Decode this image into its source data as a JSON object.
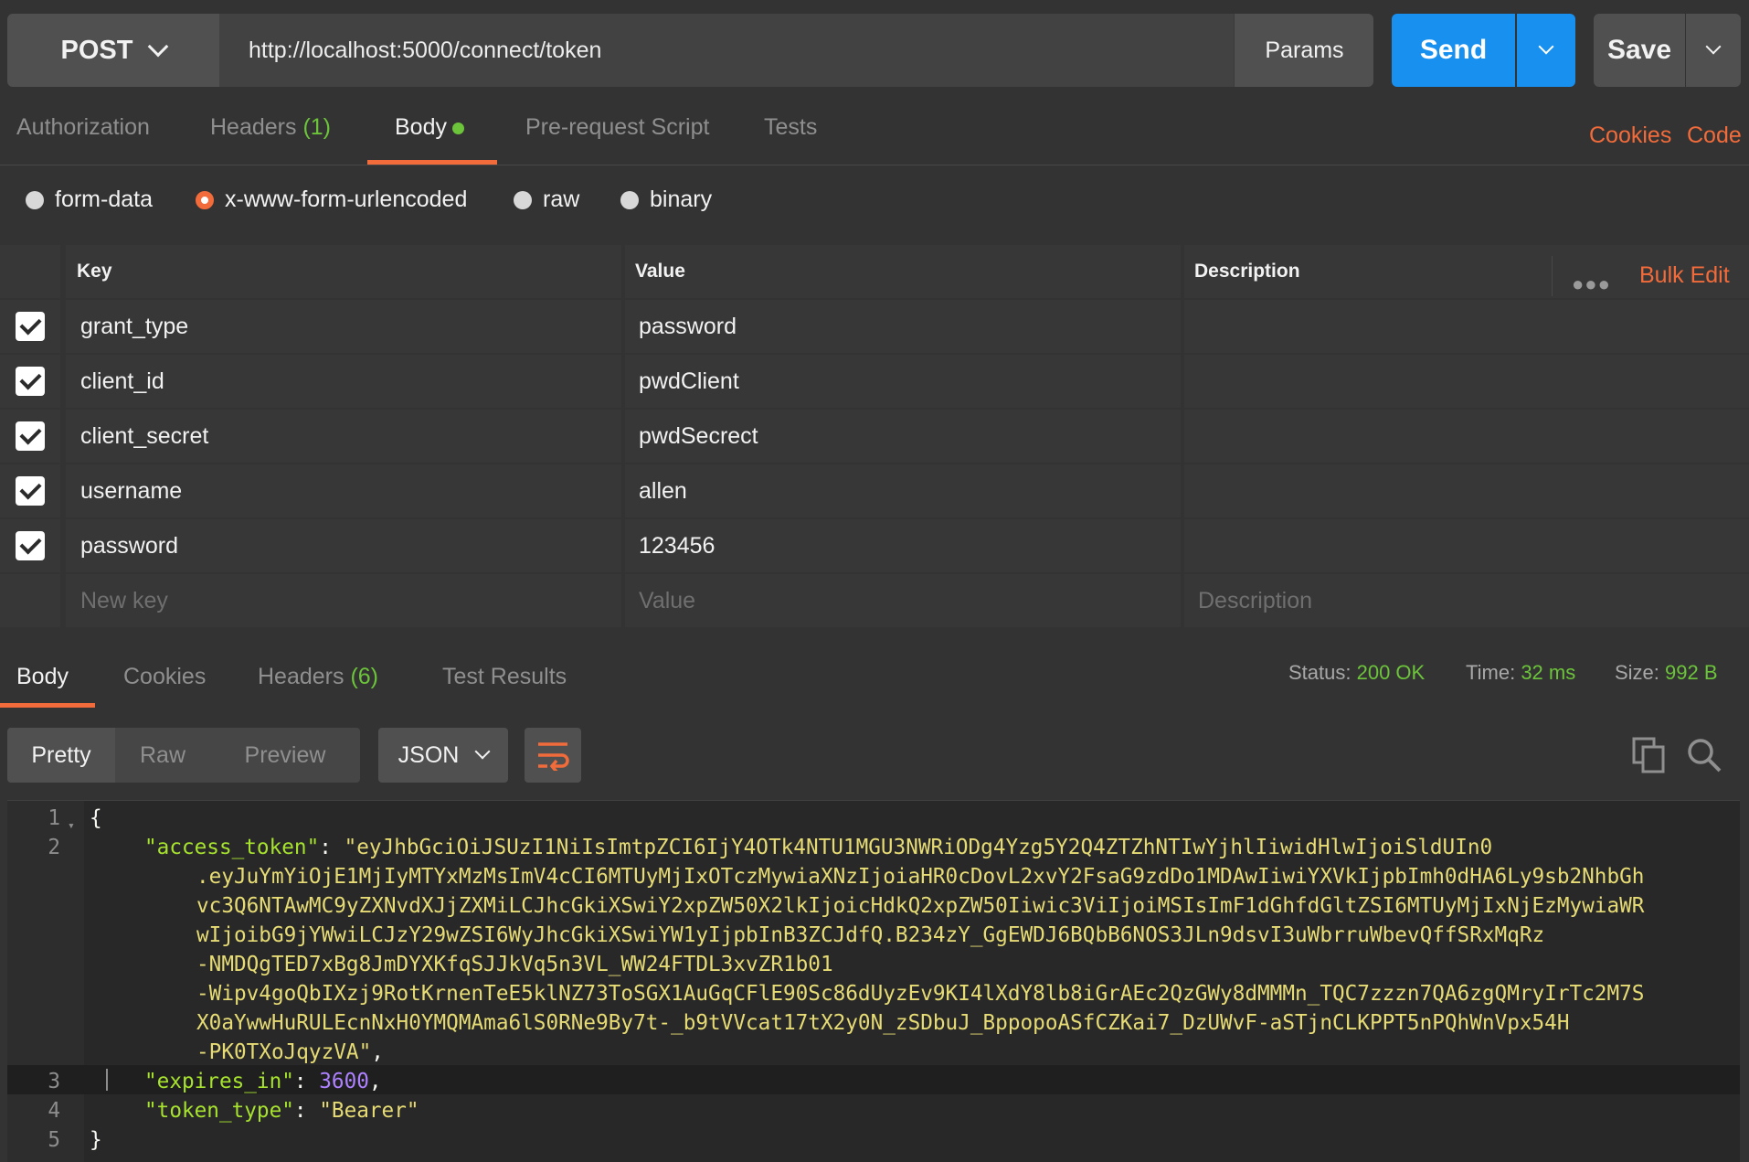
{
  "request": {
    "method": "POST",
    "url": "http://localhost:5000/connect/token",
    "params_label": "Params",
    "send_label": "Send",
    "save_label": "Save"
  },
  "request_tabs": {
    "authorization": "Authorization",
    "headers": "Headers",
    "headers_count": "(1)",
    "body": "Body",
    "prerequest": "Pre-request Script",
    "tests": "Tests",
    "cookies": "Cookies",
    "code": "Code"
  },
  "body_types": {
    "form_data": "form-data",
    "urlencoded": "x-www-form-urlencoded",
    "raw": "raw",
    "binary": "binary",
    "selected": "x-www-form-urlencoded"
  },
  "kv_table": {
    "headers": {
      "key": "Key",
      "value": "Value",
      "description": "Description",
      "bulk_edit": "Bulk Edit"
    },
    "rows": [
      {
        "key": "grant_type",
        "value": "password",
        "checked": true
      },
      {
        "key": "client_id",
        "value": "pwdClient",
        "checked": true
      },
      {
        "key": "client_secret",
        "value": "pwdSecrect",
        "checked": true
      },
      {
        "key": "username",
        "value": "allen",
        "checked": true
      },
      {
        "key": "password",
        "value": "123456",
        "checked": true
      }
    ],
    "new_row": {
      "key_placeholder": "New key",
      "value_placeholder": "Value",
      "description_placeholder": "Description"
    }
  },
  "response_tabs": {
    "body": "Body",
    "cookies": "Cookies",
    "headers": "Headers",
    "headers_count": "(6)",
    "test_results": "Test Results"
  },
  "status": {
    "status_label": "Status:",
    "status_value": "200 OK",
    "time_label": "Time:",
    "time_value": "32 ms",
    "size_label": "Size:",
    "size_value": "992 B"
  },
  "view_modes": {
    "pretty": "Pretty",
    "raw": "Raw",
    "preview": "Preview",
    "format": "JSON"
  },
  "response_body": {
    "line_numbers": [
      "1",
      "2",
      "3",
      "4",
      "5"
    ],
    "open_brace": "{",
    "close_brace": "}",
    "access_token_key": "\"access_token\"",
    "access_token_lines": [
      "\"eyJhbGciOiJSUzI1NiIsImtpZCI6IjY4OTk4NTU1MGU3NWRiODg4Yzg5Y2Q4ZTZhNTIwYjhlIiwidHlwIjoiSldUIn0",
      ".eyJuYmYiOjE1MjIyMTYxMzMsImV4cCI6MTUyMjIxOTczMywiaXNzIjoiaHR0cDovL2xvY2FsaG9zdDo1MDAwIiwiYXVkIjpbImh0dHA6Ly9sb2NhbGh",
      "vc3Q6NTAwMC9yZXNvdXJjZXMiLCJhcGkiXSwiY2xpZW50X2lkIjoicHdkQ2xpZW50Iiwic3ViIjoiMSIsImF1dGhfdGltZSI6MTUyMjIxNjEzMywiaWR",
      "wIjoibG9jYWwiLCJzY29wZSI6WyJhcGkiXSwiYW1yIjpbInB3ZCJdfQ.B234zY_GgEWDJ6BQbB6NOS3JLn9dsvI3uWbrruWbevQffSRxMqRz",
      "-NMDQgTED7xBg8JmDYXKfqSJJkVq5n3VL_WW24FTDL3xvZR1b01",
      "-Wipv4goQbIXzj9RotKrnenTeE5klNZ73ToSGX1AuGqCFlE90Sc86dUyzEv9KI4lXdY8lb8iGrAEc2QzGWy8dMMMn_TQC7zzzn7QA6zgQMryIrTc2M7S",
      "X0aYwwHuRULEcnNxH0YMQMAma6lS0RNe9By7t-_b9tVVcat17tX2y0N_zSDbuJ_BppopoASfCZKai7_DzUWvF-aSTjnCLKPPT5nPQhWnVpx54H",
      "-PK0TXoJqyzVA\""
    ],
    "expires_in_key": "\"expires_in\"",
    "expires_in_value": "3600",
    "token_type_key": "\"token_type\"",
    "token_type_value": "\"Bearer\""
  },
  "icons": {
    "method_dropdown": "chevron-down-icon",
    "send_dropdown": "chevron-down-icon",
    "save_dropdown": "chevron-down-icon",
    "wrap": "wrap-lines-icon",
    "copy": "copy-icon",
    "search": "search-icon",
    "more": "more-dots-icon"
  },
  "colors": {
    "accent": "#f26b3a",
    "send": "#1790f0",
    "success": "#6cc43a",
    "json_key": "#a6e22e",
    "json_string": "#e6db74",
    "json_number": "#ae81ff"
  }
}
